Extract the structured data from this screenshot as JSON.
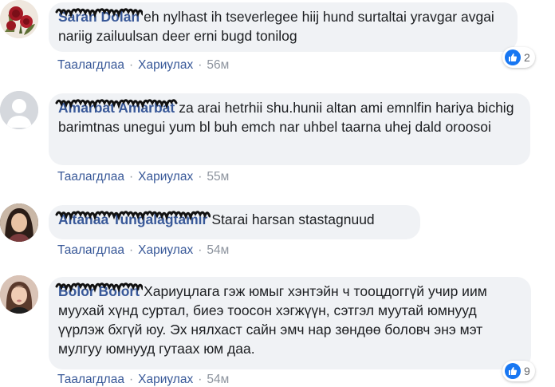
{
  "actions": {
    "like_label": "Таалагдлаа",
    "reply_label": "Хариулах",
    "separator": "·"
  },
  "comments": [
    {
      "author": "Sarah Dolan",
      "text": "eh nylhast ih tseverlegee hiij hund surtaltai yravgar avgai nariig zailuulsan deer erni bugd tonilog",
      "time": "56м",
      "reactions": "2"
    },
    {
      "author": "Amarbat Amarbat",
      "text": "za arai hetrhii shu.hunii altan ami emnlfin hariya bichig barimtnas unegui yum bl buh emch nar uhbel taarna uhej dald oroosoi",
      "time": "55м"
    },
    {
      "author": "Altanaa Tungalagtamir",
      "text": "Starai harsan stastagnuud",
      "time": "54м"
    },
    {
      "author": "Bolor Bolort",
      "text": "Хариуцлага гэж юмыг хэнтэйн ч тооцдоггүй учир иим муухай хүнд суртал, биеэ тоосон хэгжүүн, сэтгэл муутай юмнууд үүрлэж бхгүй юу. Эх нялхаст сайн эмч нар зөндөө боловч энэ мэт мулгуу юмнууд гутаах юм даа.",
      "time": "54м",
      "reactions": "9"
    }
  ],
  "colors": {
    "link": "#385898",
    "bubble": "#f0f2f5",
    "muted": "#8d949e",
    "like": "#1877f2"
  }
}
